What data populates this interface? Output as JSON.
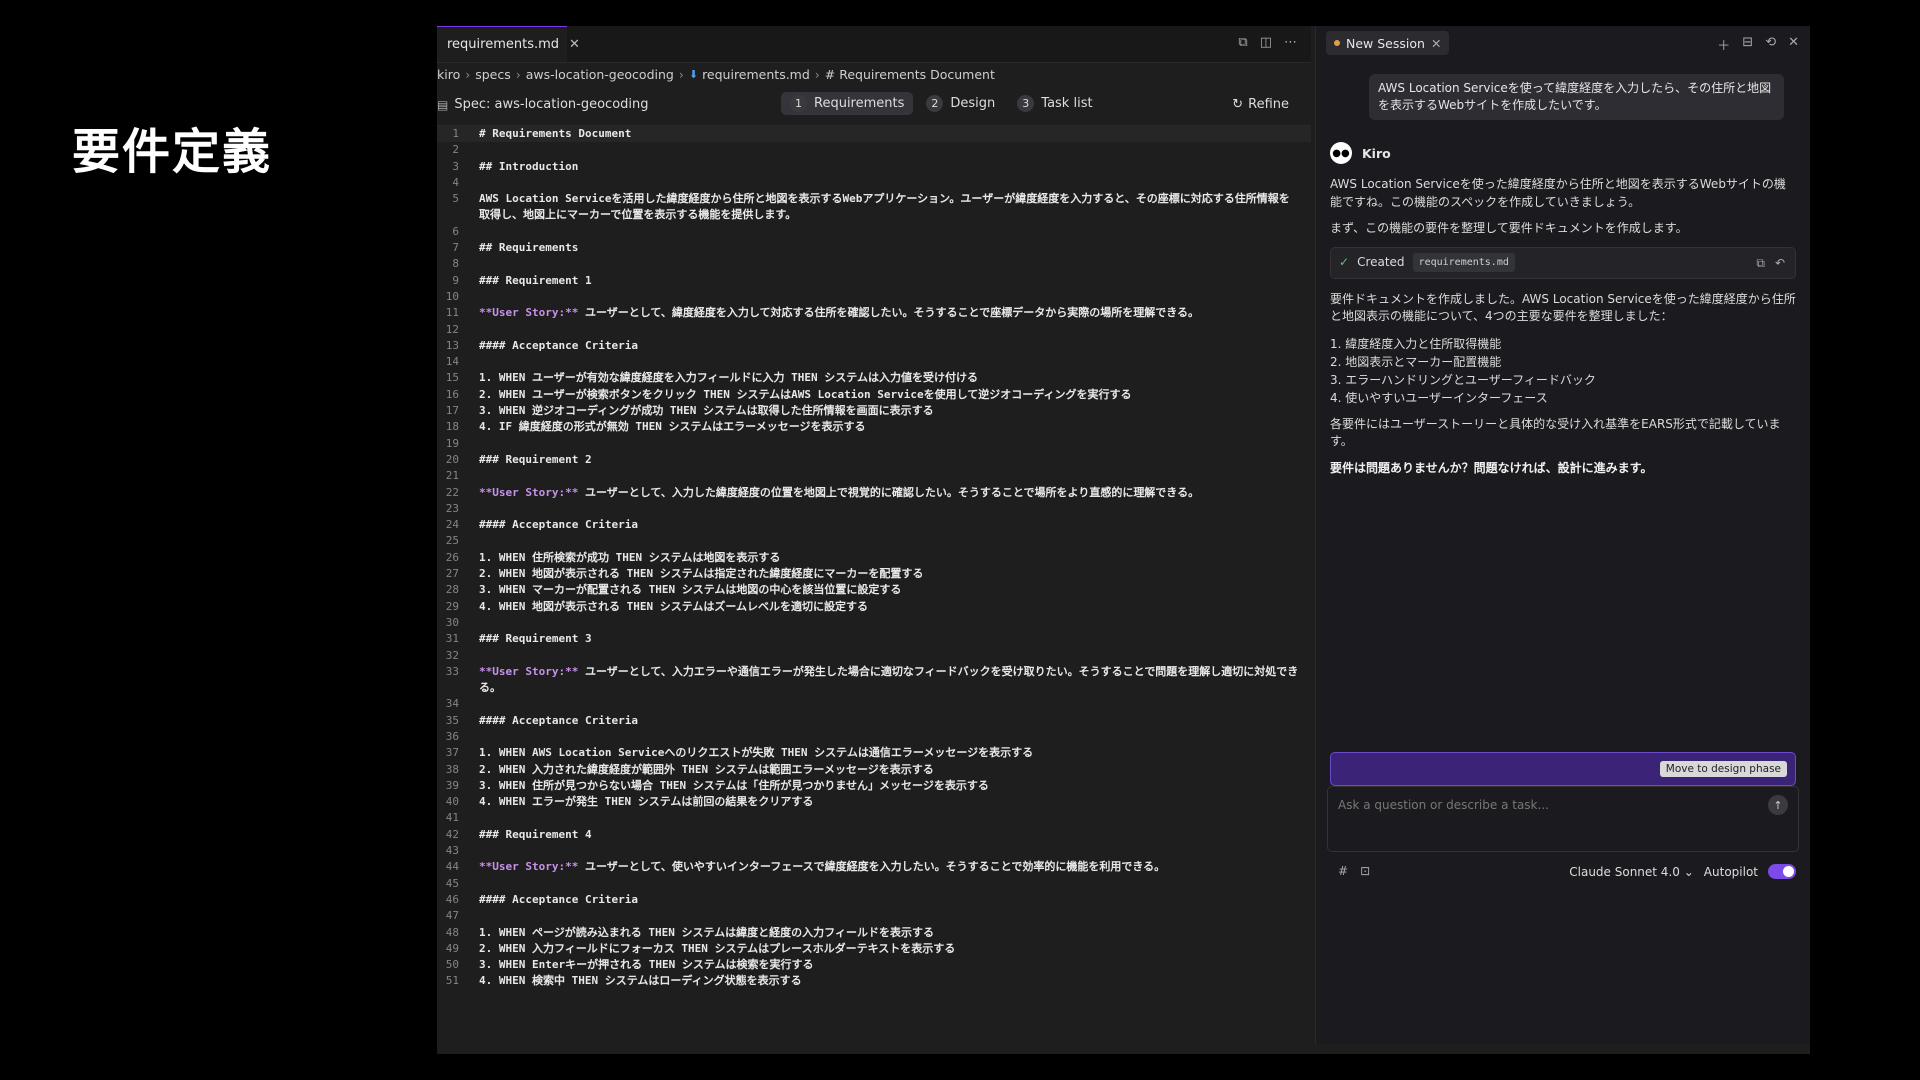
{
  "slide": {
    "title": "要件定義"
  },
  "editor": {
    "tab_label": "requirements.md",
    "breadcrumb": [
      "kiro",
      "specs",
      "aws-location-geocoding",
      "requirements.md",
      "# Requirements Document"
    ],
    "spec_label": "Spec: aws-location-geocoding",
    "steps": [
      {
        "num": "1",
        "label": "Requirements"
      },
      {
        "num": "2",
        "label": "Design"
      },
      {
        "num": "3",
        "label": "Task list"
      }
    ],
    "refine_label": "Refine",
    "lines": [
      "# Requirements Document",
      "",
      "## Introduction",
      "",
      "AWS Location Serviceを活用した緯度経度から住所と地図を表示するWebアプリケーション。ユーザーが緯度経度を入力すると、その座標に対応する住所情報を取得し、地図上にマーカーで位置を表示する機能を提供します。",
      "",
      "## Requirements",
      "",
      "### Requirement 1",
      "",
      "**User Story:** ユーザーとして、緯度経度を入力して対応する住所を確認したい。そうすることで座標データから実際の場所を理解できる。",
      "",
      "#### Acceptance Criteria",
      "",
      "1. WHEN ユーザーが有効な緯度経度を入力フィールドに入力 THEN システムは入力値を受け付ける",
      "2. WHEN ユーザーが検索ボタンをクリック THEN システムはAWS Location Serviceを使用して逆ジオコーディングを実行する",
      "3. WHEN 逆ジオコーディングが成功 THEN システムは取得した住所情報を画面に表示する",
      "4. IF 緯度経度の形式が無効 THEN システムはエラーメッセージを表示する",
      "",
      "### Requirement 2",
      "",
      "**User Story:** ユーザーとして、入力した緯度経度の位置を地図上で視覚的に確認したい。そうすることで場所をより直感的に理解できる。",
      "",
      "#### Acceptance Criteria",
      "",
      "1. WHEN 住所検索が成功 THEN システムは地図を表示する",
      "2. WHEN 地図が表示される THEN システムは指定された緯度経度にマーカーを配置する",
      "3. WHEN マーカーが配置される THEN システムは地図の中心を該当位置に設定する",
      "4. WHEN 地図が表示される THEN システムはズームレベルを適切に設定する",
      "",
      "### Requirement 3",
      "",
      "**User Story:** ユーザーとして、入力エラーや通信エラーが発生した場合に適切なフィードバックを受け取りたい。そうすることで問題を理解し適切に対処できる。",
      "",
      "#### Acceptance Criteria",
      "",
      "1. WHEN AWS Location Serviceへのリクエストが失敗 THEN システムは通信エラーメッセージを表示する",
      "2. WHEN 入力された緯度経度が範囲外 THEN システムは範囲エラーメッセージを表示する",
      "3. WHEN 住所が見つからない場合 THEN システムは「住所が見つかりません」メッセージを表示する",
      "4. WHEN エラーが発生 THEN システムは前回の結果をクリアする",
      "",
      "### Requirement 4",
      "",
      "**User Story:** ユーザーとして、使いやすいインターフェースで緯度経度を入力したい。そうすることで効率的に機能を利用できる。",
      "",
      "#### Acceptance Criteria",
      "",
      "1. WHEN ページが読み込まれる THEN システムは緯度と経度の入力フィールドを表示する",
      "2. WHEN 入力フィールドにフォーカス THEN システムはプレースホルダーテキストを表示する",
      "3. WHEN Enterキーが押される THEN システムは検索を実行する",
      "4. WHEN 検索中 THEN システムはローディング状態を表示する"
    ]
  },
  "chat": {
    "session_tab": "New Session",
    "user_message": "AWS Location Serviceを使って緯度経度を入力したら、その住所と地図を表示するWebサイトを作成したいです。",
    "assistant_name": "Kiro",
    "paragraph_1": "AWS Location Serviceを使った緯度経度から住所と地図を表示するWebサイトの機能ですね。この機能のスペックを作成していきましょう。",
    "paragraph_2": "まず、この機能の要件を整理して要件ドキュメントを作成します。",
    "created_label": "Created",
    "created_file": "requirements.md",
    "paragraph_3": "要件ドキュメントを作成しました。AWS Location Serviceを使った緯度経度から住所と地図表示の機能について、4つの主要な要件を整理しました：",
    "list": [
      "1. 緯度経度入力と住所取得機能",
      "2. 地図表示とマーカー配置機能",
      "3. エラーハンドリングとユーザーフィードバック",
      "4. 使いやすいユーザーインターフェース"
    ],
    "paragraph_4": "各要件にはユーザーストーリーと具体的な受け入れ基準をEARS形式で記載しています。",
    "paragraph_5": "要件は問題ありませんか？問題なければ、設計に進みます。",
    "phase_button": "Move to design phase",
    "input_placeholder": "Ask a question or describe a task...",
    "model_label": "Claude Sonnet 4.0",
    "autopilot_label": "Autopilot"
  }
}
